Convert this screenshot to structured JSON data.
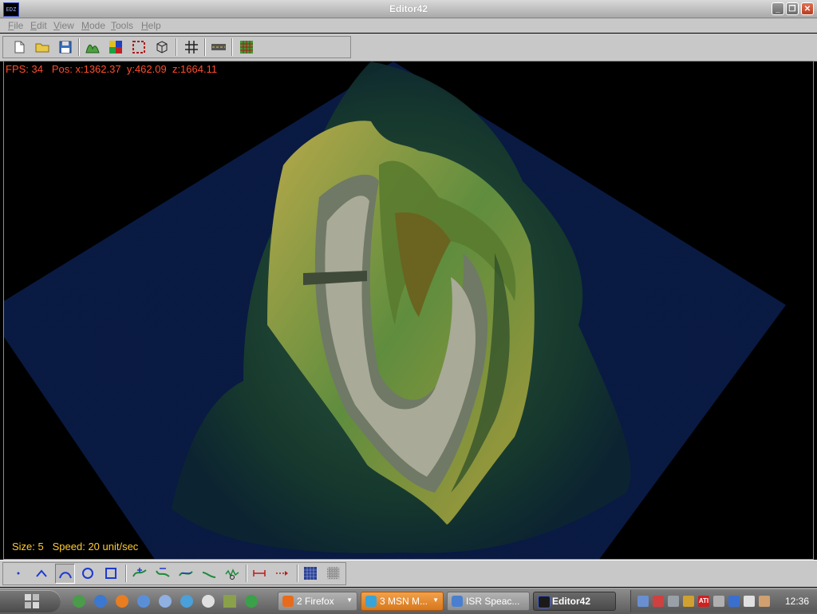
{
  "window": {
    "title": "Editor42",
    "icon_text": "EDZ"
  },
  "menu": [
    {
      "label": "File",
      "ul": "F",
      "rest": "ile"
    },
    {
      "label": "Edit",
      "ul": "E",
      "rest": "dit"
    },
    {
      "label": "View",
      "ul": "V",
      "rest": "iew"
    },
    {
      "label": "Mode",
      "ul": "M",
      "rest": "ode"
    },
    {
      "label": "Tools",
      "ul": "T",
      "rest": "ools"
    },
    {
      "label": "Help",
      "ul": "H",
      "rest": "elp"
    }
  ],
  "toolbar": {
    "icons": [
      "new-file-icon",
      "open-folder-icon",
      "save-icon",
      "terrain-icon",
      "texture-paint-icon",
      "selection-icon",
      "object-cube-icon",
      "grid-icon",
      "road-icon",
      "tile-grid-icon"
    ]
  },
  "hud": {
    "fps_label": "FPS:",
    "fps": "34",
    "pos_label": "Pos:",
    "x": "x:1362.37",
    "y": "y:462.09",
    "z": "z:1664.11",
    "size_label": "Size:",
    "size": "5",
    "speed_label": "Speed:",
    "speed": "20 unit/sec"
  },
  "bottom_toolbar": {
    "icons": [
      "point-brush-icon",
      "peak-brush-icon",
      "smooth-brush-icon",
      "circle-brush-icon",
      "square-brush-icon",
      "raise-terrain-icon",
      "lower-terrain-icon",
      "flatten-terrain-icon",
      "smooth-terrain-icon",
      "noise-terrain-icon",
      "measure-icon",
      "path-arrow-icon",
      "texture-a-icon",
      "texture-b-icon"
    ],
    "pressed_index": 2
  },
  "taskbar": {
    "tasks": [
      {
        "label": "2 Firefox",
        "icon": "firefox-icon",
        "color": "#e86b1c",
        "arrow": true
      },
      {
        "label": "3 MSN M...",
        "icon": "msn-icon",
        "color": "#3aa3d8",
        "arrow": true,
        "active": true
      },
      {
        "label": "ISR Speac...",
        "icon": "document-icon",
        "color": "#4a7fd0",
        "arrow": false
      },
      {
        "label": "Editor42",
        "icon": "editor-icon",
        "color": "#1a1a1a",
        "arrow": false,
        "bold": true
      }
    ],
    "clock": "12:36"
  },
  "colors": {
    "hud_red": "#ff4d2e",
    "hud_yellow": "#ffcc33"
  }
}
